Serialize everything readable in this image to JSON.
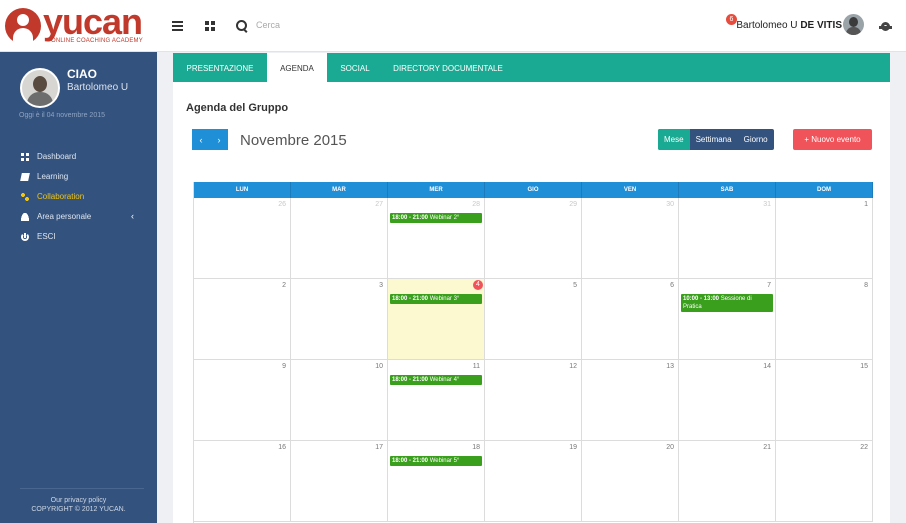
{
  "header": {
    "logo_word": "yucan",
    "logo_tag": "ONLINE COACHING ACADEMY",
    "search_placeholder": "Cerca",
    "user_first": "Bartolomeo U ",
    "user_last": "DE VITIS",
    "notifications": "6"
  },
  "sidebar": {
    "greeting": "CIAO",
    "name": "Bartolomeo U",
    "date": "Oggi è il 04 novembre 2015",
    "items": [
      {
        "label": "Dashboard",
        "icon": "dashboard-icon"
      },
      {
        "label": "Learning",
        "icon": "book-icon"
      },
      {
        "label": "Collaboration",
        "icon": "share-icon"
      },
      {
        "label": "Area personale",
        "icon": "user-icon"
      },
      {
        "label": "ESCI",
        "icon": "power-icon"
      }
    ],
    "privacy": "Our privacy policy",
    "copyright": "COPYRIGHT © 2012 YUCAN."
  },
  "tabs": [
    "PRESENTAZIONE",
    "AGENDA",
    "SOCIAL",
    "DIRECTORY DOCUMENTALE"
  ],
  "calendar": {
    "title": "Agenda del Gruppo",
    "prev": "‹",
    "next": "›",
    "month": "Novembre 2015",
    "views": [
      "Mese",
      "Settimana",
      "Giorno"
    ],
    "new_event": "+ Nuovo evento",
    "days": [
      "LUN",
      "MAR",
      "MER",
      "GIO",
      "VEN",
      "SAB",
      "DOM"
    ],
    "weeks": [
      [
        {
          "n": "26",
          "o": true
        },
        {
          "n": "27",
          "o": true
        },
        {
          "n": "28",
          "o": true,
          "ev": "Webinar 2°",
          "t": "18:00 - 21:00"
        },
        {
          "n": "29",
          "o": true
        },
        {
          "n": "30",
          "o": true
        },
        {
          "n": "31",
          "o": true
        },
        {
          "n": "1"
        }
      ],
      [
        {
          "n": "2"
        },
        {
          "n": "3"
        },
        {
          "n": "4",
          "today": true,
          "ev": "Webinar 3°",
          "t": "18:00 - 21:00"
        },
        {
          "n": "5"
        },
        {
          "n": "6"
        },
        {
          "n": "7",
          "ev": "Sessione di Pratica",
          "t": "10:00 - 13:00"
        },
        {
          "n": "8"
        }
      ],
      [
        {
          "n": "9"
        },
        {
          "n": "10"
        },
        {
          "n": "11",
          "ev": "Webinar 4°",
          "t": "18:00 - 21:00"
        },
        {
          "n": "12"
        },
        {
          "n": "13"
        },
        {
          "n": "14"
        },
        {
          "n": "15"
        }
      ],
      [
        {
          "n": "16"
        },
        {
          "n": "17"
        },
        {
          "n": "18",
          "ev": "Webinar 5°",
          "t": "18:00 - 21:00"
        },
        {
          "n": "19"
        },
        {
          "n": "20"
        },
        {
          "n": "21"
        },
        {
          "n": "22"
        }
      ]
    ]
  }
}
